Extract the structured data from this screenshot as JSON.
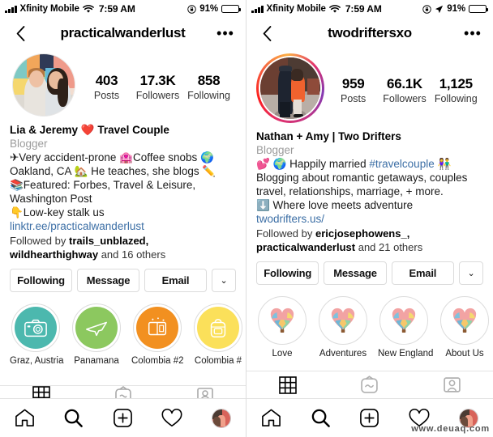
{
  "panels": [
    {
      "status": {
        "signal_icon": "signal-bars-icon",
        "carrier": "Xfinity Mobile",
        "wifi_icon": "wifi-icon",
        "time": "7:59 AM",
        "lock_icon": "rotation-lock-icon",
        "battery_pct": "91%",
        "battery_icon": "battery-icon"
      },
      "nav": {
        "back_icon": "chevron-left-icon",
        "title": "practicalwanderlust",
        "more_icon": "more-options-icon"
      },
      "avatar": {
        "name": "profile-avatar",
        "has_story_ring": false
      },
      "stats": [
        {
          "num": "403",
          "label": "Posts"
        },
        {
          "num": "17.3K",
          "label": "Followers"
        },
        {
          "num": "858",
          "label": "Following"
        }
      ],
      "bio": {
        "name": "Lia & Jeremy ❤️ Travel Couple",
        "category": "Blogger",
        "lines": [
          "✈Very accident-prone 🏩Coffee snobs 🌍",
          "Oakland, CA 🏡 He teaches, she blogs ✏️",
          "📚Featured: Forbes, Travel & Leisure,",
          "Washington Post",
          "👇Low-key stalk us"
        ],
        "link": "linktr.ee/practicalwanderlust",
        "followed_prefix": "Followed by ",
        "followed_users": "trails_unblazed, wildhearthighway",
        "followed_suffix": " and 16 others"
      },
      "buttons": [
        {
          "label": "Following",
          "name": "following-button"
        },
        {
          "label": "Message",
          "name": "message-button"
        },
        {
          "label": "Email",
          "name": "email-button"
        },
        {
          "label": "⌄",
          "name": "more-actions-button"
        }
      ],
      "highlights": [
        {
          "label": "Graz, Austria",
          "color": "#4cb8ae",
          "icon": "camera-icon"
        },
        {
          "label": "Panamana",
          "color": "#8cc85f",
          "icon": "airplane-icon"
        },
        {
          "label": "Colombia #2",
          "color": "#f29020",
          "icon": "ticket-icon"
        },
        {
          "label": "Colombia #",
          "color": "#fbe05a",
          "icon": "backpack-icon"
        }
      ],
      "tabs": [
        {
          "name": "tab-grid",
          "icon": "grid-icon",
          "active": true
        },
        {
          "name": "tab-igtv",
          "icon": "igtv-icon",
          "active": false
        },
        {
          "name": "tab-tagged",
          "icon": "tagged-icon",
          "active": false
        }
      ],
      "bottom_nav": [
        {
          "name": "nav-home",
          "icon": "home-icon"
        },
        {
          "name": "nav-search",
          "icon": "search-icon"
        },
        {
          "name": "nav-add",
          "icon": "plus-square-icon"
        },
        {
          "name": "nav-activity",
          "icon": "heart-icon"
        },
        {
          "name": "nav-profile",
          "icon": "profile-avatar-icon"
        }
      ]
    },
    {
      "status": {
        "signal_icon": "signal-bars-icon",
        "carrier": "Xfinity Mobile",
        "wifi_icon": "wifi-icon",
        "time": "7:59 AM",
        "lock_icon": "rotation-lock-icon",
        "location_icon": "location-arrow-icon",
        "battery_pct": "91%",
        "battery_icon": "battery-icon"
      },
      "nav": {
        "back_icon": "chevron-left-icon",
        "title": "twodriftersxo",
        "more_icon": "more-options-icon"
      },
      "avatar": {
        "name": "profile-avatar",
        "has_story_ring": true
      },
      "stats": [
        {
          "num": "959",
          "label": "Posts"
        },
        {
          "num": "66.1K",
          "label": "Followers"
        },
        {
          "num": "1,125",
          "label": "Following"
        }
      ],
      "bio": {
        "name": "Nathan + Amy | Two Drifters",
        "category": "Blogger",
        "lines": [
          "💕 🌍 Happily married #travelcouple 👫",
          "Blogging about romantic getaways, couples",
          "travel, relationships, marriage, + more.",
          "⬇️ Where love meets adventure"
        ],
        "hashtag": "#travelcouple",
        "link": "twodrifters.us/",
        "followed_prefix": "Followed by ",
        "followed_users": "ericjosephowens_, practicalwanderlust",
        "followed_suffix": " and 21 others"
      },
      "buttons": [
        {
          "label": "Following",
          "name": "following-button"
        },
        {
          "label": "Message",
          "name": "message-button"
        },
        {
          "label": "Email",
          "name": "email-button"
        },
        {
          "label": "⌄",
          "name": "more-actions-button"
        }
      ],
      "highlights": [
        {
          "label": "Love",
          "color": "#ffffff",
          "icon": "heart-balloon-icon"
        },
        {
          "label": "Adventures",
          "color": "#ffffff",
          "icon": "heart-balloon-icon"
        },
        {
          "label": "New England",
          "color": "#ffffff",
          "icon": "heart-balloon-icon"
        },
        {
          "label": "About Us",
          "color": "#ffffff",
          "icon": "heart-balloon-icon"
        }
      ],
      "tabs": [
        {
          "name": "tab-grid",
          "icon": "grid-icon",
          "active": true
        },
        {
          "name": "tab-igtv",
          "icon": "igtv-icon",
          "active": false
        },
        {
          "name": "tab-tagged",
          "icon": "tagged-icon",
          "active": false
        }
      ],
      "bottom_nav": [
        {
          "name": "nav-home",
          "icon": "home-icon"
        },
        {
          "name": "nav-search",
          "icon": "search-icon"
        },
        {
          "name": "nav-add",
          "icon": "plus-square-icon"
        },
        {
          "name": "nav-activity",
          "icon": "heart-icon"
        },
        {
          "name": "nav-profile",
          "icon": "profile-avatar-icon"
        }
      ]
    }
  ],
  "watermark": "www.deuaq.com",
  "colors": {
    "link": "#3b6ea5",
    "muted": "#9b9b9b",
    "border": "#dbdbdb"
  }
}
